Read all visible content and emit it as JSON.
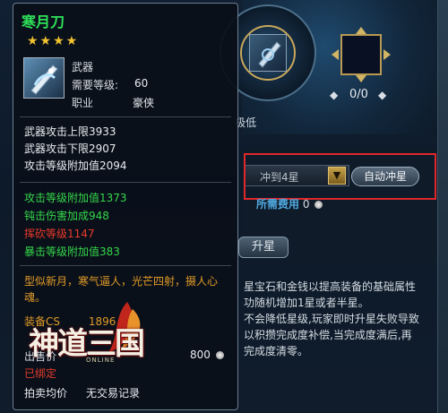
{
  "item": {
    "name": "寒月刀",
    "stars": "★★★★",
    "type": "武器",
    "level_label": "需要等级:",
    "level_value": "60",
    "class_label": "职业",
    "class_value": "豪侠"
  },
  "base_stats": [
    "武器攻击上限3933",
    "武器攻击下限2907",
    "攻击等级附加值2094"
  ],
  "bonus_stats": [
    {
      "text": "攻击等级附加值1373",
      "color": "green"
    },
    {
      "text": "钝击伤害加成948",
      "color": "green"
    },
    {
      "text": "挥砍等级1147",
      "color": "red"
    },
    {
      "text": "暴击等级附加值383",
      "color": "green"
    }
  ],
  "description": "型似新月，寒气逼人，光芒四射，摄人心魂。",
  "equip_score_label": "装备CS",
  "equip_score_value": "1896",
  "sell_label": "出售价",
  "sell_price": "800",
  "bound_text": "已绑定",
  "auction_label": "拍卖均价",
  "no_trade_label": "无交易记录",
  "logo": {
    "text": "神道三国",
    "sub": "ONLINE"
  },
  "panel": {
    "slot_count": "0/0",
    "prev_arrow": "◆",
    "next_arrow": "◆",
    "low_label": "极低",
    "target_star": "冲到4星",
    "auto_button": "自动冲星",
    "cost_label": "所需费用",
    "cost_value": "0",
    "upgrade_button": "升星",
    "info_lines": [
      "星宝石和金钱以提高装备的基础属性",
      "功随机增加1星或者半星。",
      "不会降低星级,玩家即时升星失败导致",
      "以积攒完成度补偿,当完成度满后,再",
      "完成度清零。"
    ]
  },
  "colors": {
    "name_green": "#2fe05a",
    "star_gold": "#f0c230",
    "stat_green": "#34d74a",
    "stat_red": "#ea3a2a",
    "desc_orange": "#e09a27",
    "highlight_red": "#e0282c"
  }
}
